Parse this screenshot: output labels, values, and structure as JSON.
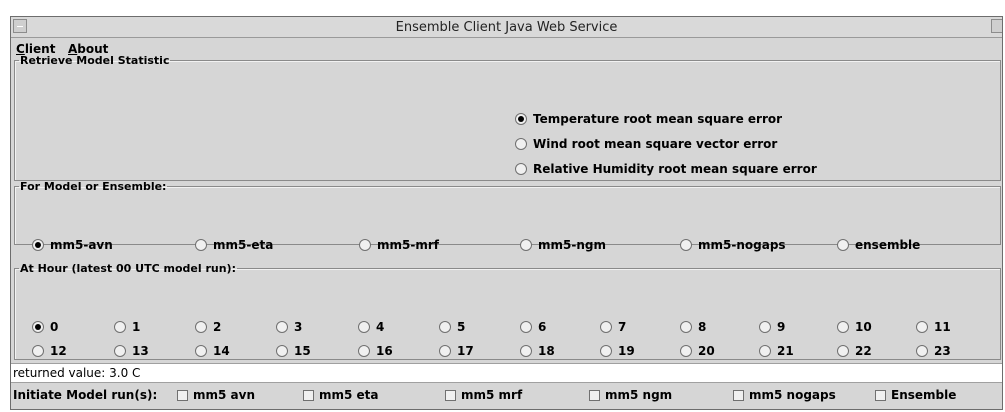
{
  "window": {
    "title": "Ensemble Client Java Web Service"
  },
  "menu": [
    {
      "label": "Client",
      "mnemonic": "C"
    },
    {
      "label": "About",
      "mnemonic": "A"
    }
  ],
  "statistic": {
    "legend": "Retrieve Model Statistic",
    "options": [
      {
        "label": "Temperature root mean square error",
        "selected": true
      },
      {
        "label": "Wind root mean square vector error",
        "selected": false
      },
      {
        "label": "Relative Humidity root mean square error",
        "selected": false
      }
    ]
  },
  "model": {
    "legend": "For Model or Ensemble:",
    "options": [
      {
        "label": "mm5-avn",
        "selected": true
      },
      {
        "label": "mm5-eta",
        "selected": false
      },
      {
        "label": "mm5-mrf",
        "selected": false
      },
      {
        "label": "mm5-ngm",
        "selected": false
      },
      {
        "label": "mm5-nogaps",
        "selected": false
      },
      {
        "label": "ensemble",
        "selected": false
      }
    ]
  },
  "hour": {
    "legend": "At Hour (latest 00 UTC model run):",
    "options": [
      "0",
      "1",
      "2",
      "3",
      "4",
      "5",
      "6",
      "7",
      "8",
      "9",
      "10",
      "11",
      "12",
      "13",
      "14",
      "15",
      "16",
      "17",
      "18",
      "19",
      "20",
      "21",
      "22",
      "23"
    ],
    "selected": "0"
  },
  "status": {
    "text": "returned value: 3.0 C"
  },
  "initiate": {
    "label": "Initiate Model run(s):",
    "options": [
      {
        "label": "mm5 avn",
        "checked": false
      },
      {
        "label": "mm5 eta",
        "checked": false
      },
      {
        "label": "mm5 mrf",
        "checked": false
      },
      {
        "label": "mm5 ngm",
        "checked": false
      },
      {
        "label": "mm5 nogaps",
        "checked": false
      },
      {
        "label": "Ensemble",
        "checked": false
      }
    ]
  }
}
